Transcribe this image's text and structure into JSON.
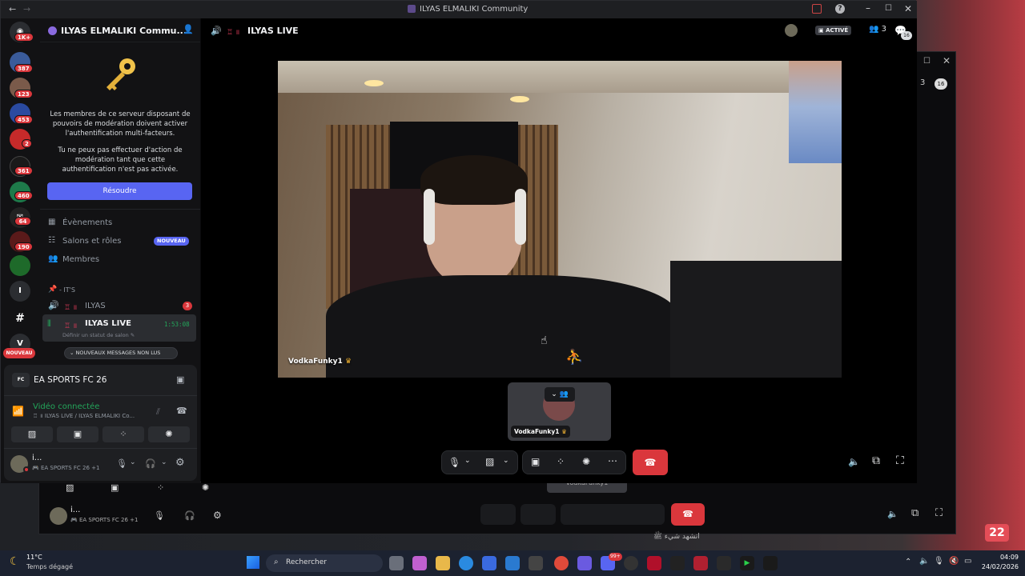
{
  "window": {
    "title": "ILYAS ELMALIKI Community"
  },
  "server": {
    "name": "ILYAS ELMALIKI Commu...",
    "mfa_text1": "Les membres de ce serveur disposant de pouvoirs de modération doivent activer l'authentification multi-facteurs.",
    "mfa_text2": "Tu ne peux pas effectuer d'action de modération tant que cette authentification n'est pas activée.",
    "resolve_label": "Résoudre"
  },
  "nav": {
    "events": "Évènements",
    "channels_roles": "Salons et rôles",
    "new_badge": "NOUVEAU",
    "members": "Membres"
  },
  "category": {
    "label": "- IT'S"
  },
  "channels": [
    {
      "name": "ILYAS",
      "prefix": "♖ ॥",
      "badge": "3"
    },
    {
      "name": "ILYAS LIVE",
      "prefix": "♖ ॥",
      "timer": "1:53:08",
      "status": "Définir un statut de salon"
    }
  ],
  "unread_pill": "NOUVEAUX MESSAGES NON LUS",
  "activity": {
    "game": "EA SPORTS FC 26"
  },
  "voice": {
    "status": "Vidéo connectée",
    "location": "♖ ॥ ILYAS LIVE / ILYAS ELMALIKI Co..."
  },
  "user": {
    "name": "i...",
    "activity": "EA SPORTS FC 26",
    "extra": "+1"
  },
  "guild_badges": [
    "1K+",
    "387",
    "123",
    "453",
    "2",
    "361",
    "460",
    "64",
    "190"
  ],
  "guild_new": "NOUVEAU",
  "guild_letters": {
    "i": "I",
    "v": "V"
  },
  "header": {
    "channel": "ILYAS LIVE",
    "prefix": "♖ ॥",
    "activity_badge": "ACTIVÉ",
    "members_count": "3",
    "chat_count": "16"
  },
  "video": {
    "streamer": "VodkaFunky1"
  },
  "tile": {
    "name": "VodkaFunky1"
  },
  "back": {
    "count": "3",
    "chat": "16",
    "tile_name": "VodkaFunky1",
    "user_name": "i...",
    "user_activity": "EA SPORTS FC 26",
    "user_extra": "+1",
    "arabic": "اتشهد شيء ﷺ"
  },
  "overlay_badge": "22",
  "taskbar": {
    "temp": "11°C",
    "weather": "Temps dégagé",
    "search": "Rechercher",
    "time": "04:09",
    "date": "24/02/2026",
    "notif": "99+"
  }
}
